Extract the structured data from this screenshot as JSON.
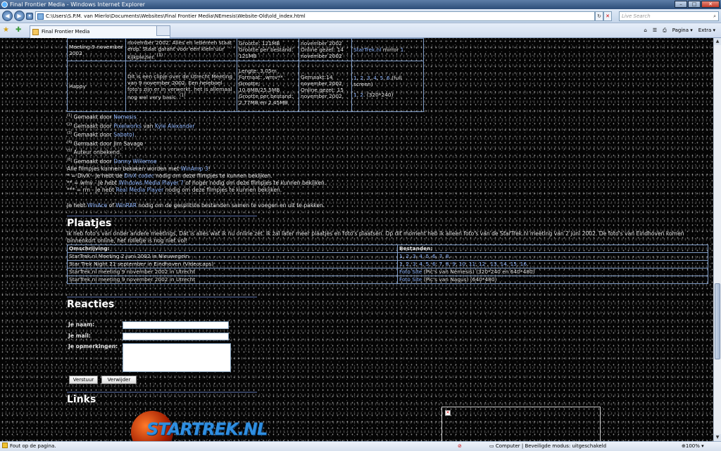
{
  "window": {
    "title": "Final Frontier Media - Windows Internet Explorer",
    "buttons": {
      "minimize": "–",
      "maximize": "□",
      "close": "✕"
    }
  },
  "address": {
    "url": "C:\\Users\\S.P.M. van Mierlo\\Documents\\Websites\\Final Frontier Media\\NEmesis\\Website-Old\\old_index.html",
    "search_placeholder": "Live Search"
  },
  "tab": {
    "title": "Final Frontier Media"
  },
  "toolbar": {
    "home": "⌂",
    "feeds": "☰",
    "print": "⎙",
    "page": "Pagina ▾",
    "tools": "Extra ▾"
  },
  "films": {
    "rows": [
      {
        "name": "Meeting 9 november 2002",
        "desc": "november 2002. Alles en iedereen staat erop. Staat garant voor een klein uur kijkplezier. ",
        "desc_note": "(1)",
        "info": [
          "Grootte: 121MB",
          "Grootte per bestand: 121MB"
        ],
        "dates": [
          "november 2002",
          "Online gezet: 14 november 2002"
        ],
        "links": [
          {
            "text": "StarTrek.nl"
          },
          {
            "text": " mirror "
          },
          {
            "text": "1"
          },
          {
            "text": "."
          }
        ]
      },
      {
        "name": "Happy",
        "desc": "Dit is een clipje over de Utrecht Meeting van 9 november 2002. Een heleboel foto's zijn er in verwerkt. het is allemaal nog wel very basic. ",
        "desc_note": "(1)",
        "info": [
          "Lengte: 3.05m",
          "Formaat: .wmv**",
          "Grootte: 10.8MB/25.5MB",
          "Grootte per bestand: 2,77MB en 2,45MB"
        ],
        "dates": [
          "Gemaakt:14 november 2002",
          "Online gezet: 15 november 2002."
        ],
        "links_full": [
          "1",
          "2",
          "3",
          "4",
          "5",
          "6"
        ],
        "full_label": ".(full screen)",
        "links_small": [
          "1",
          "2"
        ],
        "small_label": ". (320*240)"
      }
    ]
  },
  "footnotes": [
    {
      "n": "(1)",
      "text": " Gemaakt door ",
      "link": "Nemesis",
      "rest": ""
    },
    {
      "n": "(2)",
      "text": " Gemaakt door ",
      "link": "Pixelworks",
      "rest": " van ",
      "link2": "Kyle Alexander"
    },
    {
      "n": "(3)",
      "text": " Gemaakt door ",
      "link": "Sabato)",
      "rest": ""
    },
    {
      "n": "(4)",
      "text": " Gemaakt door Jim Savage",
      "link": "",
      "rest": ""
    },
    {
      "n": "(5)",
      "text": " Auteur onbekend.",
      "link": "",
      "rest": ""
    },
    {
      "n": "(6)",
      "text": " Gemaakt door ",
      "link": "Danny Willemse",
      "rest": ""
    }
  ],
  "notes": {
    "line1_pre": "Alle filmpjes kunnen bekeken worden met ",
    "line1_link": "WinAmp 3",
    "line1_post": "!",
    "line2_pre": "* = DivX - Je hebt de ",
    "line2_link": "DivX codec",
    "line2_post": " nodig om deze filmpjes te kunnen bekijken.",
    "line3_pre": "** = wmv - Je hebt ",
    "line3_link": "Windows Media Player 7",
    "line3_post": " of hoger nodig om deze filmpjes te kunnen bekijken.",
    "line4_pre": "*** = rm - Je hebt ",
    "line4_link": "Real Media Player",
    "line4_post": " nodig om deze filmpjes te kunnen bekijken.",
    "winace_pre": "Je hebt ",
    "winace_link1": "WinAce",
    "winace_mid": " of ",
    "winace_link2": "WinRAR",
    "winace_post": " nodig om de gesplitste bestanden samen te voegen en uit te pakken."
  },
  "plaatjes": {
    "heading": "Plaatjes",
    "intro": "Ik heb foto's van onder andere meetings, Dat is alles wat ik nu online zet. Ik zal later meer plaatjes en foto's plaatsen. Op dit moment heb ik alleen foto's van de StarTrek.nl meeting van 2 juni 2002. De foto's van Eindhoven komen binnenkort online, het rolletje is nog niet vol!",
    "headers": [
      "Omschrijving:",
      "Bestanden:"
    ],
    "rows": [
      {
        "desc": "StarTrek.nl Meeting 2 juni 2002 in Nieuwegein",
        "files": [
          "1",
          "2",
          "3",
          "4",
          "5",
          "6",
          "7",
          "8"
        ],
        "end": "."
      },
      {
        "desc": "Star Trek Night 21 september in Eindhoven (Videocaps)",
        "files": [
          "1",
          "2",
          "3",
          "4",
          "5",
          "6",
          "7",
          "8",
          "9",
          "10",
          "11",
          "12",
          "13",
          "14",
          "15",
          "16"
        ],
        "end": "."
      },
      {
        "desc": "StarTrek.nl meeting 9 november 2002 in Utrecht",
        "link": "Foto Site",
        "post": " (Pic's van Nemesis) (320*240 en 640*480)"
      },
      {
        "desc": "StarTrek.nl meeting 9 november 2002 in Utrecht",
        "link": "Foto Site",
        "post": " (Pic's van Nagus) (640*480)"
      }
    ]
  },
  "reacties": {
    "heading": "Reacties",
    "name_label": "Je naam:",
    "mail_label": "Je mail:",
    "comments_label": "Je opmerkingen:",
    "submit": "Verstuur",
    "reset": "Verwijder"
  },
  "links": {
    "heading": "Links",
    "logo_text": "STARTREK.NL",
    "ad_broken": "✕"
  },
  "status": {
    "text": "Fout op de pagina.",
    "zone": "Computer | Beveiligde modus: uitgeschakeld",
    "zoom": "100%"
  }
}
